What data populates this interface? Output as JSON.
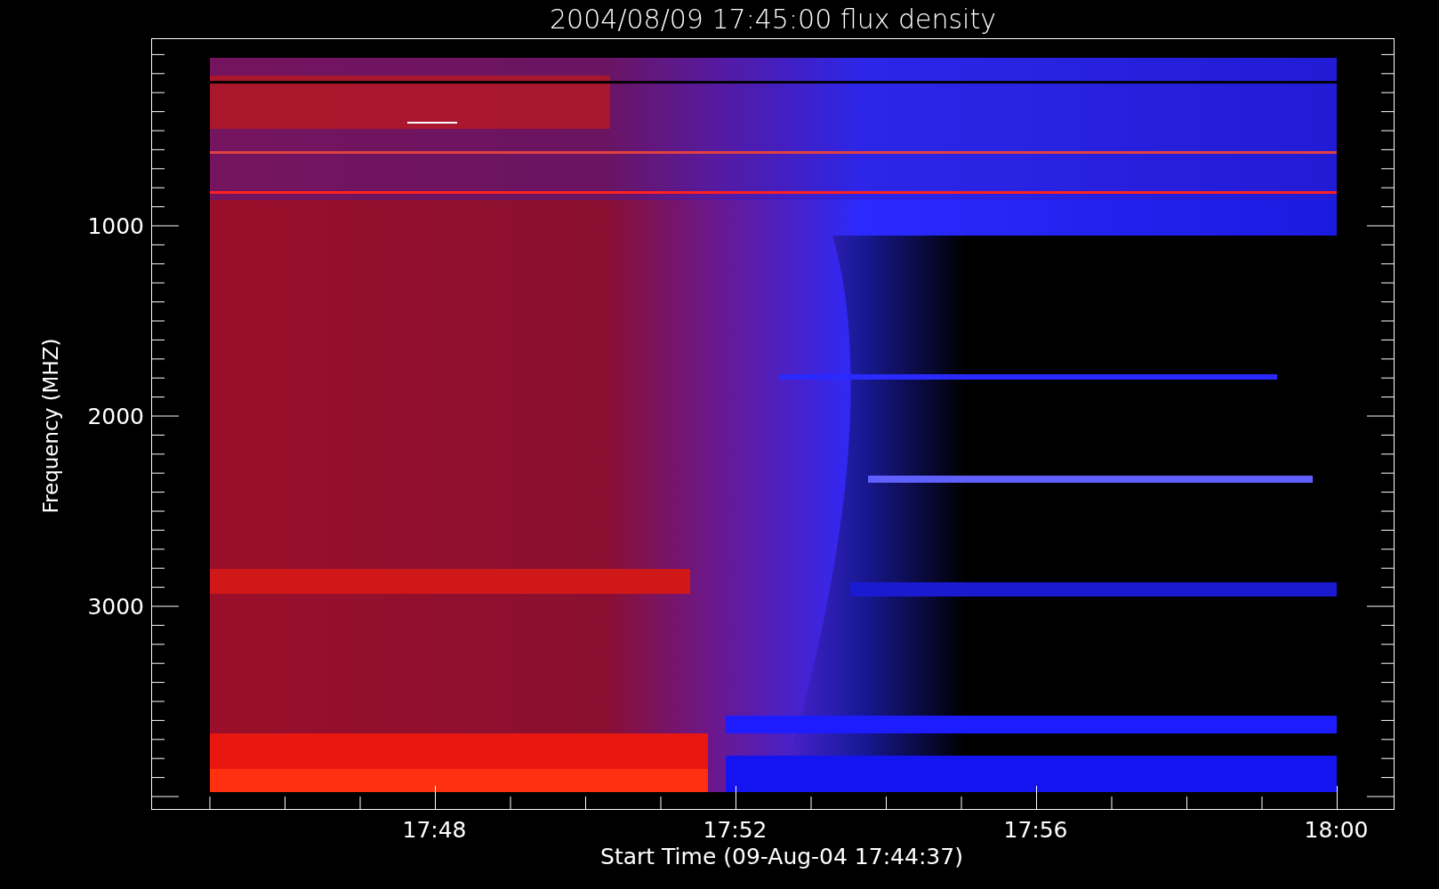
{
  "title": "2004/08/09 17:45:00 flux density",
  "y_axis": {
    "label": "Frequency (MHZ)",
    "ticks": [
      "1000",
      "2000",
      "3000"
    ]
  },
  "x_axis": {
    "label": "Start Time (09-Aug-04 17:44:37)",
    "ticks": [
      "17:48",
      "17:52",
      "17:56",
      "18:00"
    ]
  }
}
